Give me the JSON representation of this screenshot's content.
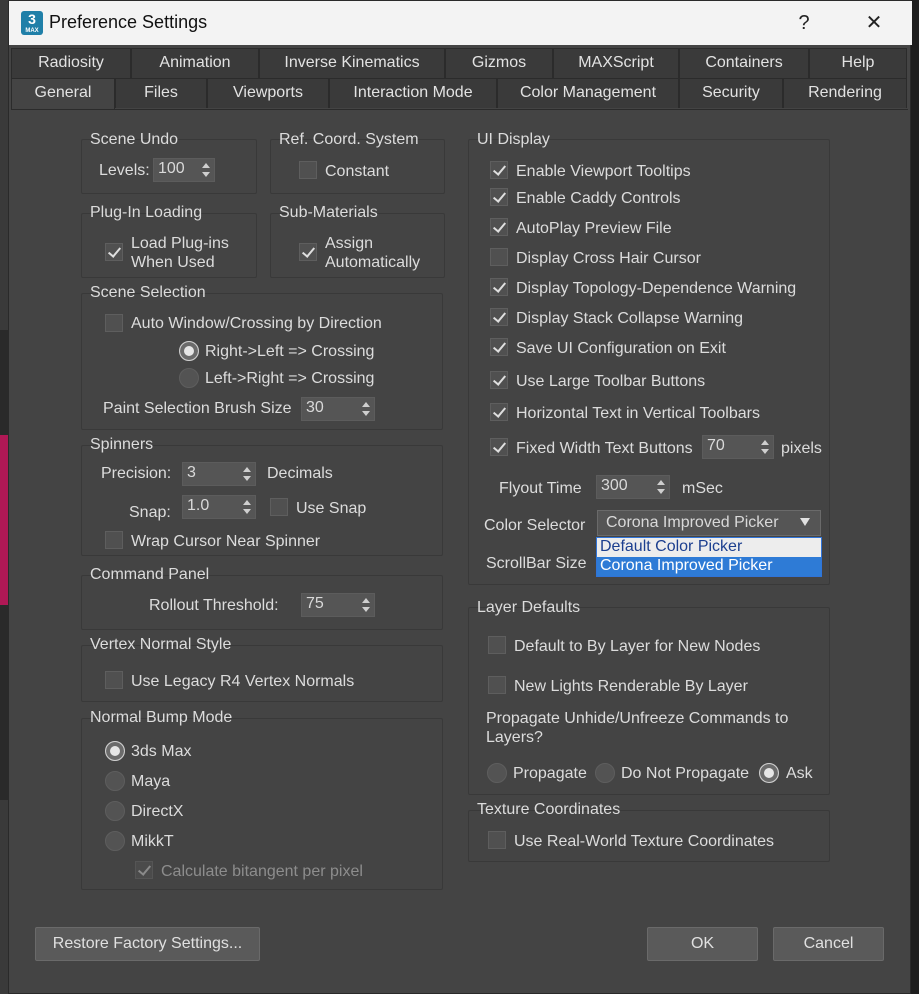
{
  "window": {
    "title": "Preference Settings",
    "help_button": "?",
    "close_button": "✕",
    "app_icon_text": "3",
    "app_icon_sub": "MAX"
  },
  "tabs_row1": [
    "Radiosity",
    "Animation",
    "Inverse Kinematics",
    "Gizmos",
    "MAXScript",
    "Containers",
    "Help"
  ],
  "tabs_row2": [
    "General",
    "Files",
    "Viewports",
    "Interaction Mode",
    "Color Management",
    "Security",
    "Rendering"
  ],
  "active_tab": "General",
  "scene_undo": {
    "title": "Scene Undo",
    "levels_label": "Levels:",
    "levels_value": "100"
  },
  "ref_coord": {
    "title": "Ref. Coord. System",
    "constant_label": "Constant",
    "constant_checked": false
  },
  "plugin_loading": {
    "title": "Plug-In Loading",
    "load_label_1": "Load Plug-ins",
    "load_label_2": "When Used",
    "load_checked": true
  },
  "sub_materials": {
    "title": "Sub-Materials",
    "assign_label_1": "Assign",
    "assign_label_2": "Automatically",
    "assign_checked": true
  },
  "scene_selection": {
    "title": "Scene Selection",
    "auto_window_label": "Auto Window/Crossing by Direction",
    "auto_window_checked": false,
    "right_left_label": "Right->Left => Crossing",
    "left_right_label": "Left->Right => Crossing",
    "selected_direction": "Right->Left => Crossing",
    "brush_label": "Paint Selection Brush Size",
    "brush_value": "30"
  },
  "spinners": {
    "title": "Spinners",
    "precision_label": "Precision:",
    "precision_value": "3",
    "decimals_label": "Decimals",
    "snap_label": "Snap:",
    "snap_value": "1.0",
    "use_snap_label": "Use Snap",
    "use_snap_checked": false,
    "wrap_label": "Wrap Cursor Near Spinner",
    "wrap_checked": false
  },
  "command_panel": {
    "title": "Command Panel",
    "rollout_label": "Rollout Threshold:",
    "rollout_value": "75"
  },
  "vertex_normal": {
    "title": "Vertex Normal Style",
    "legacy_label": "Use Legacy R4 Vertex Normals",
    "legacy_checked": false
  },
  "normal_bump": {
    "title": "Normal Bump Mode",
    "options": [
      "3ds Max",
      "Maya",
      "DirectX",
      "MikkT"
    ],
    "selected": "3ds Max",
    "bitangent_label": "Calculate bitangent per pixel",
    "bitangent_checked": true
  },
  "ui_display": {
    "title": "UI Display",
    "checkboxes": [
      {
        "label": "Enable Viewport Tooltips",
        "checked": true
      },
      {
        "label": "Enable Caddy Controls",
        "checked": true
      },
      {
        "label": "AutoPlay Preview File",
        "checked": true
      },
      {
        "label": "Display Cross Hair Cursor",
        "checked": false
      },
      {
        "label": "Display Topology-Dependence Warning",
        "checked": true
      },
      {
        "label": "Display Stack Collapse Warning",
        "checked": true
      },
      {
        "label": "Save UI Configuration on Exit",
        "checked": true
      },
      {
        "label": "Use Large Toolbar Buttons",
        "checked": true
      },
      {
        "label": "Horizontal Text in Vertical Toolbars",
        "checked": true
      },
      {
        "label": "Fixed Width Text Buttons",
        "checked": true
      }
    ],
    "fixed_width_value": "70",
    "pixels_label": "pixels",
    "flyout_label": "Flyout Time",
    "flyout_value": "300",
    "msec_label": "mSec",
    "color_selector_label": "Color Selector",
    "color_selector_value": "Corona Improved Picker",
    "color_selector_options": [
      "Default Color Picker",
      "Corona Improved Picker"
    ],
    "scrollbar_label": "ScrollBar Size"
  },
  "layer_defaults": {
    "title": "Layer Defaults",
    "by_layer_nodes_label": "Default to By Layer for New Nodes",
    "by_layer_nodes_checked": false,
    "lights_label": "New Lights Renderable By Layer",
    "lights_checked": false,
    "propagate_question_1": "Propagate Unhide/Unfreeze Commands to",
    "propagate_question_2": "Layers?",
    "propagate_options": [
      "Propagate",
      "Do Not Propagate",
      "Ask"
    ],
    "propagate_selected": "Ask"
  },
  "texture_coords": {
    "title": "Texture Coordinates",
    "realworld_label": "Use Real-World Texture Coordinates",
    "realworld_checked": false
  },
  "buttons": {
    "restore": "Restore Factory Settings...",
    "ok": "OK",
    "cancel": "Cancel"
  }
}
